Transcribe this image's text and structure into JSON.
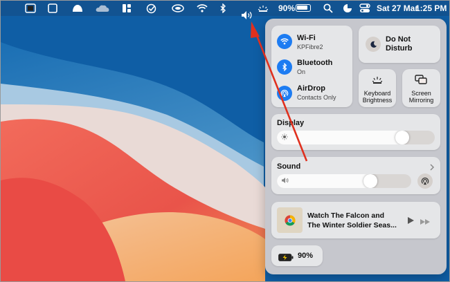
{
  "menubar": {
    "battery_percent": "90%",
    "date": "Sat 27 Mar",
    "time": "1:25 PM"
  },
  "control_center": {
    "wifi": {
      "title": "Wi-Fi",
      "subtitle": "KPFibre2"
    },
    "bluetooth": {
      "title": "Bluetooth",
      "subtitle": "On"
    },
    "airdrop": {
      "title": "AirDrop",
      "subtitle": "Contacts Only"
    },
    "dnd": {
      "title": "Do Not\nDisturb"
    },
    "keyboard": {
      "line1": "Keyboard",
      "line2": "Brightness"
    },
    "mirroring": {
      "line1": "Screen",
      "line2": "Mirroring"
    },
    "display": {
      "title": "Display",
      "level": 0.82
    },
    "sound": {
      "title": "Sound",
      "level": 0.72
    },
    "now_playing": {
      "line1": "Watch The Falcon and",
      "line2": "The Winter Soldier Seas..."
    },
    "battery": {
      "percent": "90%"
    }
  },
  "colors": {
    "accent": "#1d7cf2",
    "arrow": "#e0301e"
  }
}
